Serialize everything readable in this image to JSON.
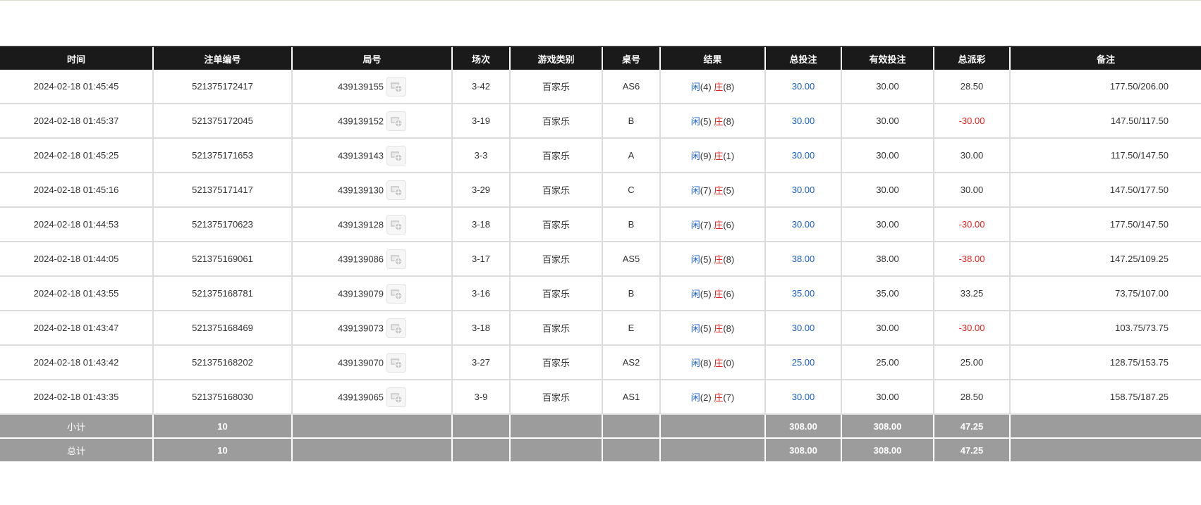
{
  "headers": [
    "时间",
    "注单编号",
    "局号",
    "场次",
    "游戏类别",
    "桌号",
    "结果",
    "总投注",
    "有效投注",
    "总派彩",
    "备注"
  ],
  "rows": [
    {
      "time": "2024-02-18 01:45:45",
      "bet_id": "521375172417",
      "round": "439139155",
      "session": "3-42",
      "game": "百家乐",
      "table": "AS6",
      "player_label": "闲",
      "player_score": "(4)",
      "banker_label": "庄",
      "banker_score": "(8)",
      "total_bet": "30.00",
      "valid_bet": "30.00",
      "payout": "28.50",
      "payout_negative": false,
      "remark": "177.50/206.00"
    },
    {
      "time": "2024-02-18 01:45:37",
      "bet_id": "521375172045",
      "round": "439139152",
      "session": "3-19",
      "game": "百家乐",
      "table": "B",
      "player_label": "闲",
      "player_score": "(5)",
      "banker_label": "庄",
      "banker_score": "(8)",
      "total_bet": "30.00",
      "valid_bet": "30.00",
      "payout": "-30.00",
      "payout_negative": true,
      "remark": "147.50/117.50"
    },
    {
      "time": "2024-02-18 01:45:25",
      "bet_id": "521375171653",
      "round": "439139143",
      "session": "3-3",
      "game": "百家乐",
      "table": "A",
      "player_label": "闲",
      "player_score": "(9)",
      "banker_label": "庄",
      "banker_score": "(1)",
      "total_bet": "30.00",
      "valid_bet": "30.00",
      "payout": "30.00",
      "payout_negative": false,
      "remark": "117.50/147.50"
    },
    {
      "time": "2024-02-18 01:45:16",
      "bet_id": "521375171417",
      "round": "439139130",
      "session": "3-29",
      "game": "百家乐",
      "table": "C",
      "player_label": "闲",
      "player_score": "(7)",
      "banker_label": "庄",
      "banker_score": "(5)",
      "total_bet": "30.00",
      "valid_bet": "30.00",
      "payout": "30.00",
      "payout_negative": false,
      "remark": "147.50/177.50"
    },
    {
      "time": "2024-02-18 01:44:53",
      "bet_id": "521375170623",
      "round": "439139128",
      "session": "3-18",
      "game": "百家乐",
      "table": "B",
      "player_label": "闲",
      "player_score": "(7)",
      "banker_label": "庄",
      "banker_score": "(6)",
      "total_bet": "30.00",
      "valid_bet": "30.00",
      "payout": "-30.00",
      "payout_negative": true,
      "remark": "177.50/147.50"
    },
    {
      "time": "2024-02-18 01:44:05",
      "bet_id": "521375169061",
      "round": "439139086",
      "session": "3-17",
      "game": "百家乐",
      "table": "AS5",
      "player_label": "闲",
      "player_score": "(5)",
      "banker_label": "庄",
      "banker_score": "(8)",
      "total_bet": "38.00",
      "valid_bet": "38.00",
      "payout": "-38.00",
      "payout_negative": true,
      "remark": "147.25/109.25"
    },
    {
      "time": "2024-02-18 01:43:55",
      "bet_id": "521375168781",
      "round": "439139079",
      "session": "3-16",
      "game": "百家乐",
      "table": "B",
      "player_label": "闲",
      "player_score": "(5)",
      "banker_label": "庄",
      "banker_score": "(6)",
      "total_bet": "35.00",
      "valid_bet": "35.00",
      "payout": "33.25",
      "payout_negative": false,
      "remark": "73.75/107.00"
    },
    {
      "time": "2024-02-18 01:43:47",
      "bet_id": "521375168469",
      "round": "439139073",
      "session": "3-18",
      "game": "百家乐",
      "table": "E",
      "player_label": "闲",
      "player_score": "(5)",
      "banker_label": "庄",
      "banker_score": "(8)",
      "total_bet": "30.00",
      "valid_bet": "30.00",
      "payout": "-30.00",
      "payout_negative": true,
      "remark": "103.75/73.75"
    },
    {
      "time": "2024-02-18 01:43:42",
      "bet_id": "521375168202",
      "round": "439139070",
      "session": "3-27",
      "game": "百家乐",
      "table": "AS2",
      "player_label": "闲",
      "player_score": "(8)",
      "banker_label": "庄",
      "banker_score": "(0)",
      "total_bet": "25.00",
      "valid_bet": "25.00",
      "payout": "25.00",
      "payout_negative": false,
      "remark": "128.75/153.75"
    },
    {
      "time": "2024-02-18 01:43:35",
      "bet_id": "521375168030",
      "round": "439139065",
      "session": "3-9",
      "game": "百家乐",
      "table": "AS1",
      "player_label": "闲",
      "player_score": "(2)",
      "banker_label": "庄",
      "banker_score": "(7)",
      "total_bet": "30.00",
      "valid_bet": "30.00",
      "payout": "28.50",
      "payout_negative": false,
      "remark": "158.75/187.25"
    }
  ],
  "subtotal": {
    "label": "小计",
    "count": "10",
    "total_bet": "308.00",
    "valid_bet": "308.00",
    "payout": "47.25"
  },
  "grandtotal": {
    "label": "总计",
    "count": "10",
    "total_bet": "308.00",
    "valid_bet": "308.00",
    "payout": "47.25"
  },
  "colors": {
    "header_bg": "#1a1a1a",
    "sum_bg": "#9c9c9c",
    "blue": "#1a5fc8",
    "red": "#e8201a"
  },
  "icons": {
    "round_detail": "video-replay-icon"
  }
}
